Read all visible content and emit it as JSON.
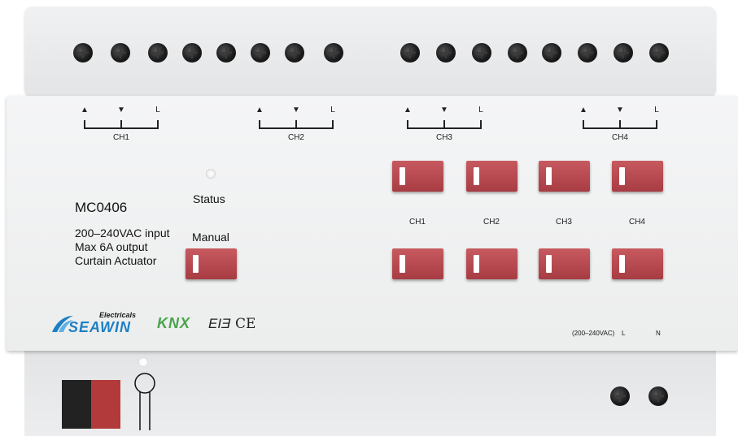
{
  "device": {
    "model": "MC0406",
    "spec_lines": [
      "200–240VAC input",
      "Max 6A output",
      "Curtain Actuator"
    ],
    "status_label": "Status",
    "manual_label": "Manual",
    "power_label": "(200–240VAC)",
    "l_label": "L",
    "n_label": "N"
  },
  "top_channels": [
    {
      "label": "CH1",
      "up": "▲",
      "down": "▼",
      "l": "L"
    },
    {
      "label": "CH2",
      "up": "▲",
      "down": "▼",
      "l": "L"
    },
    {
      "label": "CH3",
      "up": "▲",
      "down": "▼",
      "l": "L"
    },
    {
      "label": "CH4",
      "up": "▲",
      "down": "▼",
      "l": "L"
    }
  ],
  "button_labels": [
    "CH1",
    "CH2",
    "CH3",
    "CH4"
  ],
  "brand": {
    "sub": "Electricals",
    "name": "SEAWIN"
  },
  "certs": {
    "knx": "KNX",
    "eac": "EIƎ",
    "ce": "CE"
  },
  "colors": {
    "button_red": "#b8474d",
    "brand_blue": "#1e7fc4",
    "knx_green": "#4aa44a",
    "knx_gray": "#5a5a5a"
  }
}
